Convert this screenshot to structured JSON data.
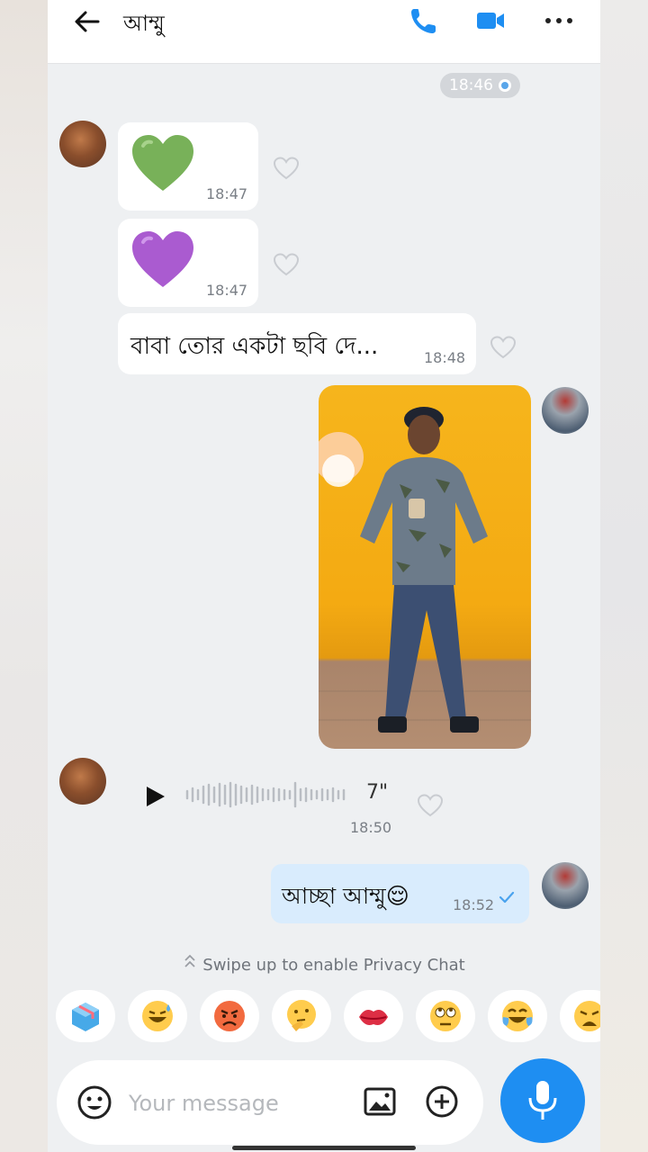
{
  "header": {
    "title": "আম্মু",
    "icons": [
      "back-arrow-icon",
      "phone-icon",
      "video-camera-icon",
      "more-icon"
    ]
  },
  "date_marker": {
    "time": "18:46"
  },
  "messages": [
    {
      "type": "emoji",
      "emoji": "green-heart",
      "time": "18:47"
    },
    {
      "type": "emoji",
      "emoji": "purple-heart",
      "time": "18:47"
    },
    {
      "type": "text",
      "text": "বাবা তোর একটা ছবি দে...",
      "time": "18:48"
    },
    {
      "type": "image"
    },
    {
      "type": "voice",
      "duration": "7\"",
      "time": "18:50"
    },
    {
      "type": "text",
      "text": "আচ্ছা আম্মু😌",
      "time": "18:52"
    }
  ],
  "privacy": {
    "text": "Swipe up to enable Privacy Chat"
  },
  "quick_emojis": [
    "gift-box",
    "grinning-sweat",
    "angry-face",
    "thinking-face",
    "kiss-lips",
    "rolling-eyes",
    "tears-of-joy",
    "weary-face"
  ],
  "composer": {
    "placeholder": "Your message"
  },
  "colors": {
    "accent": "#1e8ef2",
    "my_bubble": "#d9ecfd",
    "header_blue": "#1e8ef2"
  }
}
